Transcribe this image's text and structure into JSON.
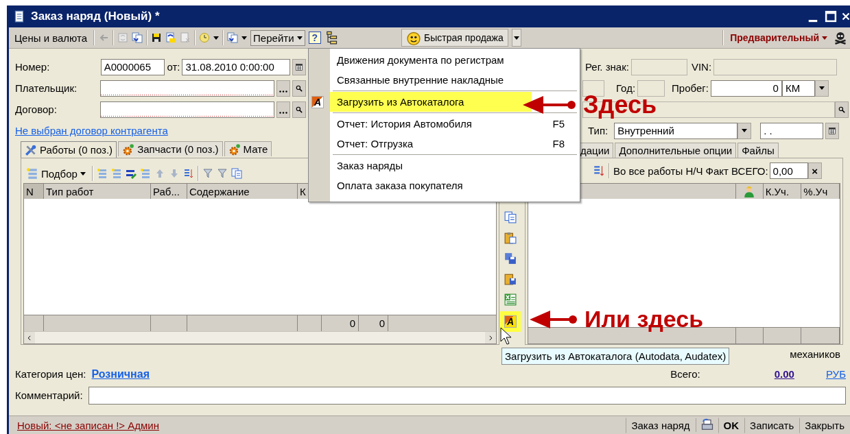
{
  "window": {
    "title": "Заказ наряд (Новый) *"
  },
  "toolbar": {
    "prices_button": "Цены и валюта",
    "help": "?",
    "quick_sale": "Быстрая продажа",
    "status": "Предварительный"
  },
  "goto_menu": {
    "label": "Перейти",
    "open": true,
    "groups": [
      [
        {
          "label": "Движения документа по регистрам",
          "highlighted": false
        },
        {
          "label": "Связанные внутренние накладные",
          "highlighted": false
        }
      ],
      [
        {
          "label": "Загрузить из Автокаталога",
          "icon_letter": "A",
          "highlighted": true
        }
      ],
      [
        {
          "label": "Отчет: История Автомобиля",
          "shortcut": "F5",
          "highlighted": false
        },
        {
          "label": "Отчет: Отгрузка",
          "shortcut": "F8",
          "highlighted": false
        }
      ],
      [
        {
          "label": "Заказ наряды",
          "highlighted": false
        },
        {
          "label": "Оплата заказа покупателя",
          "highlighted": false
        }
      ]
    ]
  },
  "header_fields": {
    "number_label": "Номер:",
    "number": "А0000065",
    "date_label": "от:",
    "date": "31.08.2010  0:00:00",
    "payer_label": "Плательщик:",
    "payer_required": true,
    "contract_label": "Договор:",
    "contract_required": true,
    "contract_link": "Не выбран договор контрагента"
  },
  "vehicle_fields": {
    "plate_label": "Рег. знак:",
    "vin_label": "VIN:",
    "year_label": "Год:",
    "mileage_label": "Пробег:",
    "mileage": "0",
    "unit": "КМ",
    "type_label": "Тип:",
    "type": "Внутренний",
    "date": ". ."
  },
  "left_tabs": [
    {
      "label": "Работы (0 поз.)",
      "selected": true
    },
    {
      "label": "Запчасти (0 поз.)",
      "selected": false
    },
    {
      "label": "Мате",
      "selected": false
    }
  ],
  "right_tabs": [
    {
      "label": "дации",
      "selected": false
    },
    {
      "label": "Дополнительные опции",
      "selected": false
    },
    {
      "label": "Файлы",
      "selected": false
    }
  ],
  "works_toolbar": {
    "pick_button": "Подбор"
  },
  "works_table": {
    "columns": [
      "N",
      "Тип работ",
      "Раб...",
      "Содержание",
      "К"
    ],
    "totals": [
      "0",
      "0"
    ]
  },
  "right_toolbar": {
    "label": "Во все работы Н/Ч Факт ВСЕГО:",
    "value": "0,00",
    "clear": "×"
  },
  "right_table": {
    "columns": [
      "К.Уч.",
      "%.Уч"
    ]
  },
  "side_buttons": {
    "autocatalog_letter": "A",
    "autocatalog_highlighted": true
  },
  "mechanics_text": "механиков",
  "price_category": {
    "label": "Категория цен:",
    "value": "Розничная"
  },
  "total": {
    "label": "Всего:",
    "value": "0.00",
    "currency": "РУБ"
  },
  "comment": {
    "label": "Комментарий:"
  },
  "status_bar": {
    "link": "Новый: <не записан !> Админ",
    "buttons": [
      {
        "label": "Заказ наряд",
        "default": false
      },
      {
        "label": "OK",
        "default": true
      },
      {
        "label": "Записать",
        "default": false
      },
      {
        "label": "Закрыть",
        "default": false
      }
    ]
  },
  "tooltip": "Загрузить из Автокаталога (Autodata, Audatex)",
  "annotations": [
    {
      "text": "Здесь"
    },
    {
      "text": "Или здесь"
    }
  ]
}
